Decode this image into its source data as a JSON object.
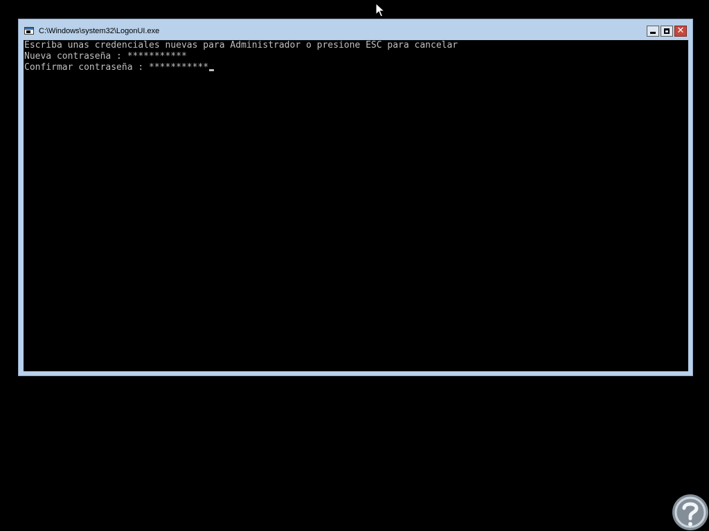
{
  "window": {
    "title": "C:\\Windows\\system32\\LogonUI.exe",
    "controls": {
      "minimize_icon": "minimize-icon",
      "maximize_icon": "maximize-icon",
      "close_icon": "close-icon",
      "close_glyph": "✕"
    }
  },
  "console": {
    "lines": [
      "Escriba unas credenciales nuevas para Administrador o presione ESC para cancelar",
      "Nueva contraseña : ***********",
      "Confirmar contraseña : ***********"
    ],
    "text_color": "#c0c0c0",
    "background": "#000000"
  },
  "colors": {
    "window_frame": "#b9d1ea",
    "close_button": "#c7483d",
    "desktop": "#000000"
  },
  "icons": {
    "app": "console-app-icon",
    "pointer": "mouse-pointer-icon",
    "watermark": "watermark-logo-icon"
  }
}
